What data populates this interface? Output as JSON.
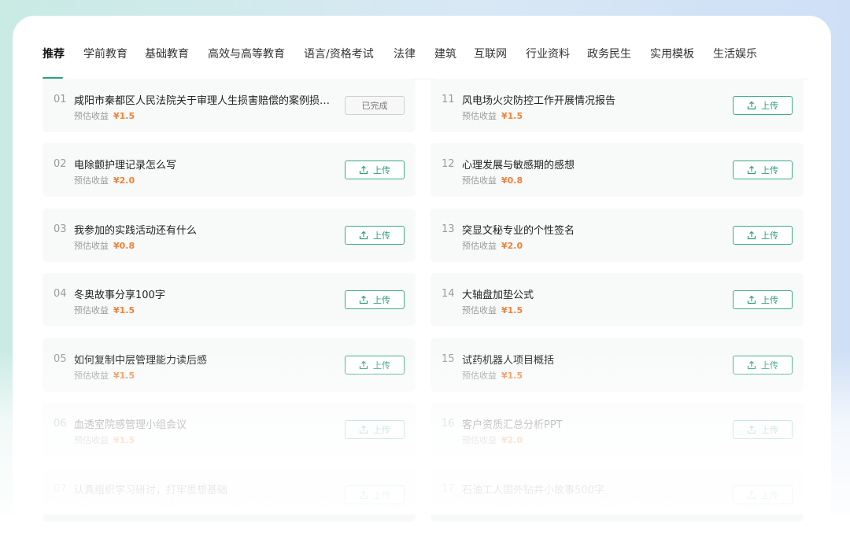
{
  "tabs": [
    {
      "label": "推荐"
    },
    {
      "label": "学前教育"
    },
    {
      "label": "基础教育"
    },
    {
      "label": "高效与高等教育"
    },
    {
      "label": "语言/资格考试"
    },
    {
      "label": "法律"
    },
    {
      "label": "建筑"
    },
    {
      "label": "互联网"
    },
    {
      "label": "行业资料"
    },
    {
      "label": "政务民生"
    },
    {
      "label": "实用模板"
    },
    {
      "label": "生活娱乐"
    }
  ],
  "active_tab": "推荐",
  "income_label": "预估收益",
  "upload_label": "上传",
  "done_label": "已完成",
  "colors": {
    "accent": "#25a482",
    "price": "#f0833a"
  },
  "left_items": [
    {
      "num": "01",
      "title": "咸阳市秦都区人民法院关于审理人生损害赔偿的案例损害…",
      "price": "¥1.5",
      "status": "已完成"
    },
    {
      "num": "02",
      "title": "电除颤护理记录怎么写",
      "price": "¥2.0",
      "status": "上传"
    },
    {
      "num": "03",
      "title": "我参加的实践活动还有什么",
      "price": "¥0.8",
      "status": "上传"
    },
    {
      "num": "04",
      "title": "冬奥故事分享100字",
      "price": "¥1.5",
      "status": "上传"
    },
    {
      "num": "05",
      "title": "如何复制中层管理能力读后感",
      "price": "¥1.5",
      "status": "上传"
    },
    {
      "num": "06",
      "title": "血透室院感管理小组会议",
      "price": "¥1.5",
      "status": "上传"
    },
    {
      "num": "07",
      "title": "认真组织学习研讨，打牢思想基础",
      "price": "",
      "status": "上传"
    }
  ],
  "right_items": [
    {
      "num": "11",
      "title": "风电场火灾防控工作开展情况报告",
      "price": "¥1.5",
      "status": "上传"
    },
    {
      "num": "12",
      "title": "心理发展与敏感期的感想",
      "price": "¥0.8",
      "status": "上传"
    },
    {
      "num": "13",
      "title": "突显文秘专业的个性签名",
      "price": "¥2.0",
      "status": "上传"
    },
    {
      "num": "14",
      "title": "大轴盘加垫公式",
      "price": "¥1.5",
      "status": "上传"
    },
    {
      "num": "15",
      "title": "试药机器人项目概括",
      "price": "¥1.5",
      "status": "上传"
    },
    {
      "num": "16",
      "title": "客户资质汇总分析PPT",
      "price": "¥2.0",
      "status": "上传"
    },
    {
      "num": "17",
      "title": "石油工人国外钻井小故事500字",
      "price": "",
      "status": "上传"
    }
  ]
}
